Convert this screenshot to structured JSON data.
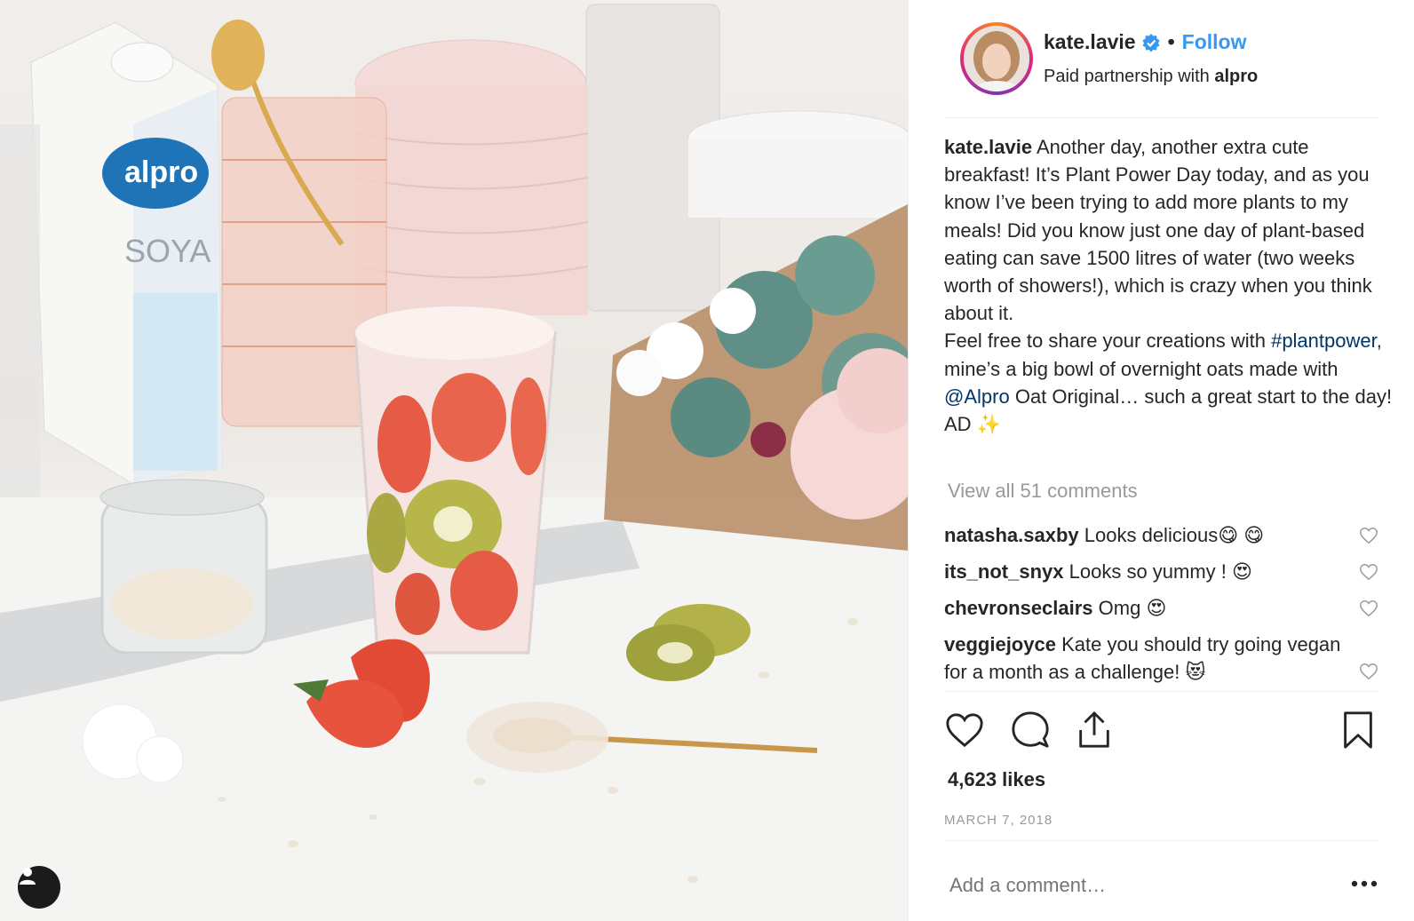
{
  "header": {
    "username": "kate.lavie",
    "separator": "•",
    "follow_label": "Follow",
    "partnership_prefix": "Paid partnership with",
    "partnership_brand": "alpro"
  },
  "caption": {
    "username": "kate.lavie",
    "text_part1": "Another day, another extra cute breakfast! It’s Plant Power Day today, and as you know I’ve been trying to add more plants to my meals! Did you know just one day of plant-based eating can save 1500 litres of water (two weeks worth of showers!), which is crazy when you think about it.",
    "text_part2": "Feel free to share your creations with",
    "hashtag": "#plantpower",
    "text_part3": ", mine’s a big bowl of overnight oats made with",
    "mention": "@Alpro",
    "text_part4": "Oat Original… such a great start to the day! AD ✨"
  },
  "view_all_comments": "View all 51 comments",
  "comments": [
    {
      "username": "natasha.saxby",
      "text": "Looks delicious😋 😋"
    },
    {
      "username": "its_not_snyx",
      "text": "Looks so yummy ! 😍"
    },
    {
      "username": "chevronseclairs",
      "text": "Omg 😍"
    },
    {
      "username": "veggiejoyce",
      "text": "Kate you should try going vegan for a month as a challenge! 😻"
    }
  ],
  "likes": "4,623 likes",
  "date": "MARCH 7, 2018",
  "add_comment_placeholder": "Add a comment…",
  "icons": [
    "user-tag-icon",
    "verified-badge-icon",
    "heart-icon",
    "comment-icon",
    "share-icon",
    "bookmark-icon",
    "more-options-icon"
  ],
  "colors": {
    "link": "#3897f0",
    "hashtag": "#003569",
    "muted": "#999999",
    "verified": "#3897f0"
  }
}
